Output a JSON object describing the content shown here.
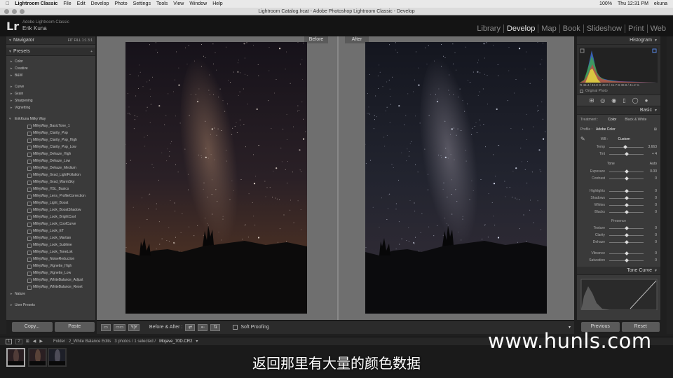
{
  "mac_menu": {
    "app": "Lightroom Classic",
    "items": [
      "File",
      "Edit",
      "Develop",
      "Photo",
      "Settings",
      "Tools",
      "View",
      "Window",
      "Help"
    ],
    "battery": "100%",
    "clock": "Thu 12:31 PM",
    "user": "ekuna"
  },
  "window_title": "Lightroom Catalog.lrcat - Adobe Photoshop Lightroom Classic - Develop",
  "identity": {
    "logo": "Lr",
    "product": "Adobe Lightroom Classic",
    "user_name": "Erik Kuna"
  },
  "modules": [
    "Library",
    "Develop",
    "Map",
    "Book",
    "Slideshow",
    "Print",
    "Web"
  ],
  "active_module": "Develop",
  "left_panel": {
    "navigator": {
      "title": "Navigator",
      "zoom_options": "FIT  FILL  1:1  3:1"
    },
    "presets": {
      "title": "Presets",
      "groups_top": [
        "Color",
        "Creative",
        "B&W"
      ],
      "groups_mid": [
        "Curve",
        "Grain",
        "Sharpening",
        "Vignetting"
      ],
      "open_group": "ErikKuna Milky Way",
      "items": [
        "MilkyWay_BasicTone_1",
        "MilkyWay_Clarity_Pop",
        "MilkyWay_Clarity_Pop_High",
        "MilkyWay_Clarity_Pop_Low",
        "MilkyWay_Dehaze_High",
        "MilkyWay_Dehaze_Low",
        "MilkyWay_Dehaze_Medium",
        "MilkyWay_Grad_LightPollution",
        "MilkyWay_Grad_WarmSky",
        "MilkyWay_HSL_Basics",
        "MilkyWay_Lens_ProfileCorrection",
        "MilkyWay_Light_Boost",
        "MilkyWay_Look_BoostShadow",
        "MilkyWay_Look_BrightCool",
        "MilkyWay_Look_CoolCurve",
        "MilkyWay_Look_ET",
        "MilkyWay_Look_Martian",
        "MilkyWay_Look_Sublime",
        "MilkyWay_Look_ToneLok",
        "MilkyWay_NoiseReduction",
        "MilkyWay_Vignette_High",
        "MilkyWay_Vignette_Low",
        "MilkyWay_WhiteBalance_Adjust",
        "MilkyWay_WhiteBalance_Reset"
      ],
      "after_group": "Nature",
      "user_presets": "User Presets"
    },
    "copy_label": "Copy...",
    "paste_label": "Paste"
  },
  "view": {
    "before_label": "Before",
    "after_label": "After"
  },
  "toolbar": {
    "yy_label": "Y|Y",
    "before_after_label": "Before & After :",
    "soft_proofing": "Soft Proofing"
  },
  "right_panel": {
    "histogram_title": "Histogram",
    "readout": "R 45.4 / 42.8   G 42.0 / 41.7   B 38.8 / 41.2 %",
    "original_photo": "Original Photo",
    "basic_title": "Basic",
    "treatment_label": "Treatment :",
    "treatment_color": "Color",
    "treatment_bw": "Black & White",
    "profile_label": "Profile :",
    "profile_value": "Adobe Color",
    "wb_label": "WB :",
    "wb_value": "Custom",
    "sliders_wb": [
      {
        "label": "Temp",
        "value": "3,663",
        "pos": 0.46
      },
      {
        "label": "Tint",
        "value": "+ 4",
        "pos": 0.52
      }
    ],
    "tone_label": "Tone",
    "auto_label": "Auto",
    "sliders_tone": [
      {
        "label": "Exposure",
        "value": "0.00",
        "pos": 0.5
      },
      {
        "label": "Contrast",
        "value": "0",
        "pos": 0.5
      }
    ],
    "sliders_tone2": [
      {
        "label": "Highlights",
        "value": "0",
        "pos": 0.5
      },
      {
        "label": "Shadows",
        "value": "0",
        "pos": 0.5
      },
      {
        "label": "Whites",
        "value": "0",
        "pos": 0.5
      },
      {
        "label": "Blacks",
        "value": "0",
        "pos": 0.5
      }
    ],
    "presence_label": "Presence",
    "sliders_presence": [
      {
        "label": "Texture",
        "value": "0",
        "pos": 0.5
      },
      {
        "label": "Clarity",
        "value": "0",
        "pos": 0.5
      },
      {
        "label": "Dehaze",
        "value": "0",
        "pos": 0.5
      }
    ],
    "sliders_presence2": [
      {
        "label": "Vibrance",
        "value": "0",
        "pos": 0.5
      },
      {
        "label": "Saturation",
        "value": "0",
        "pos": 0.5
      }
    ],
    "tone_curve_title": "Tone Curve",
    "previous_label": "Previous",
    "reset_label": "Reset"
  },
  "filmstrip_bar": {
    "page1": "1",
    "page2": "2",
    "folder_label": "Folder : 2_White Balance Edits",
    "count": "3 photos / 1 selected /",
    "filename": "Mojave_70D.CR2"
  },
  "watermark": "www.hunls.com",
  "subtitle": "返回那里有大量的颜色数据"
}
